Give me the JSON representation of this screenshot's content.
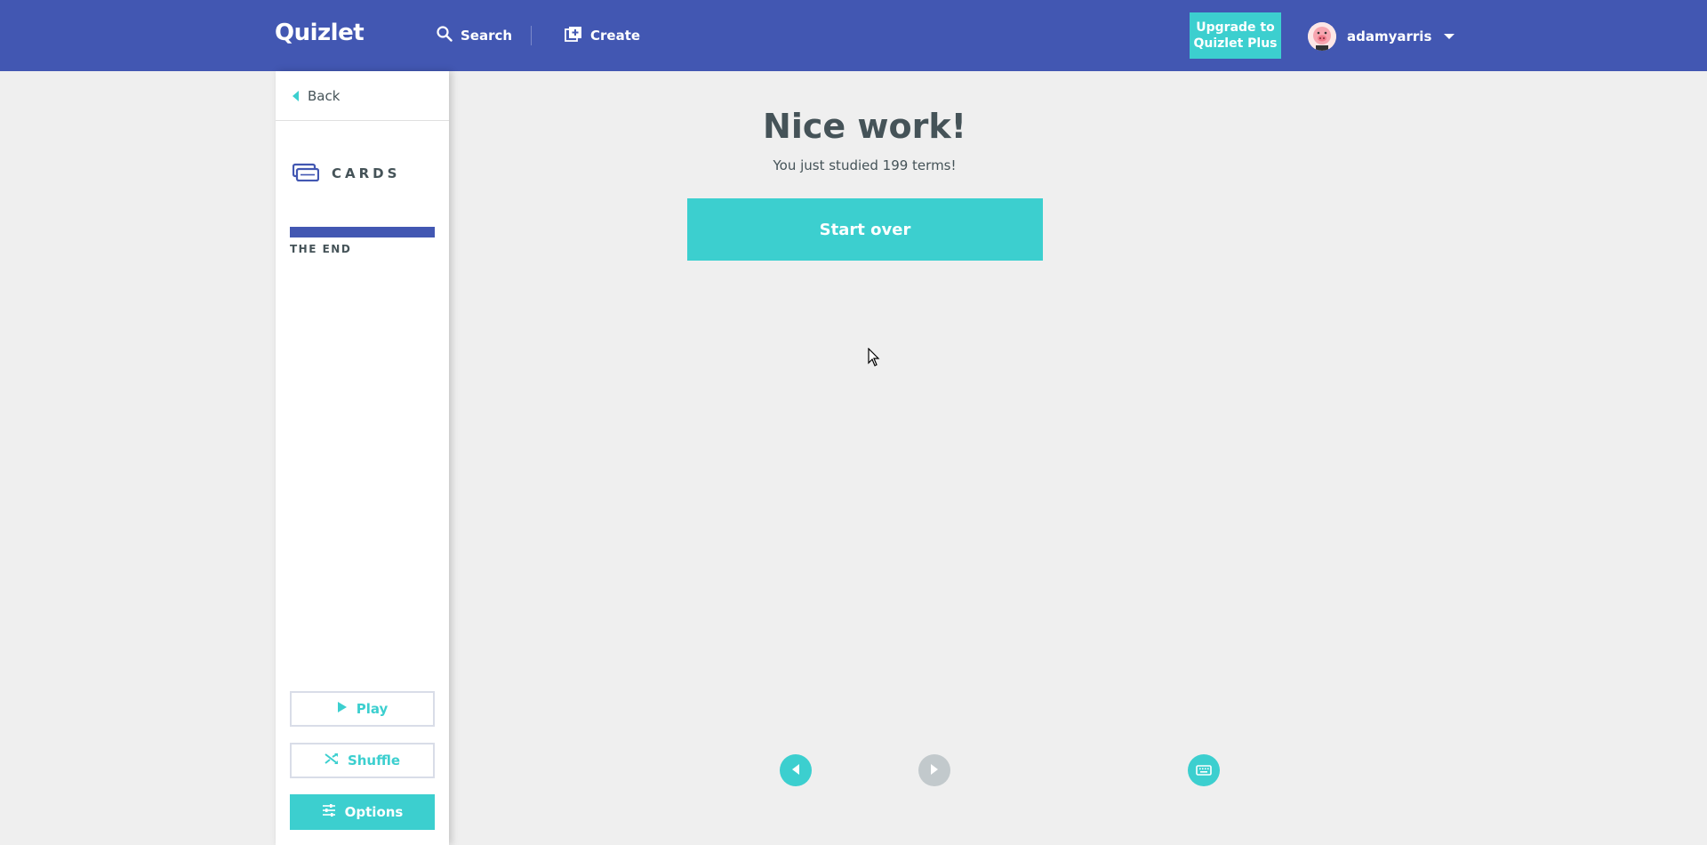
{
  "header": {
    "logo": "Quizlet",
    "search_label": "Search",
    "create_label": "Create",
    "upgrade_label": "Upgrade to Quizlet Plus",
    "username": "adamyarris"
  },
  "sidebar": {
    "back_label": "Back",
    "mode_label": "CARDS",
    "progress_fraction": 1.0,
    "progress_label": "THE END",
    "play_label": "Play",
    "shuffle_label": "Shuffle",
    "options_label": "Options"
  },
  "main": {
    "title": "Nice work!",
    "subtitle": "You just studied 199 terms!",
    "start_over_label": "Start over"
  },
  "colors": {
    "header_bg": "#4257b2",
    "accent": "#3ccfcf",
    "progress_fill": "#4257b2",
    "disabled": "#c2c9cc",
    "page_bg": "#efefef",
    "text": "#455358"
  },
  "icons": {
    "search": "search-icon",
    "create": "create-icon",
    "avatar": "pig-avatar",
    "back": "chevron-left-icon",
    "mode": "cards-icon",
    "play": "play-icon",
    "shuffle": "shuffle-icon",
    "options": "options-sliders-icon",
    "prev": "arrow-left-icon",
    "next": "arrow-right-icon",
    "keyboard": "keyboard-icon"
  }
}
